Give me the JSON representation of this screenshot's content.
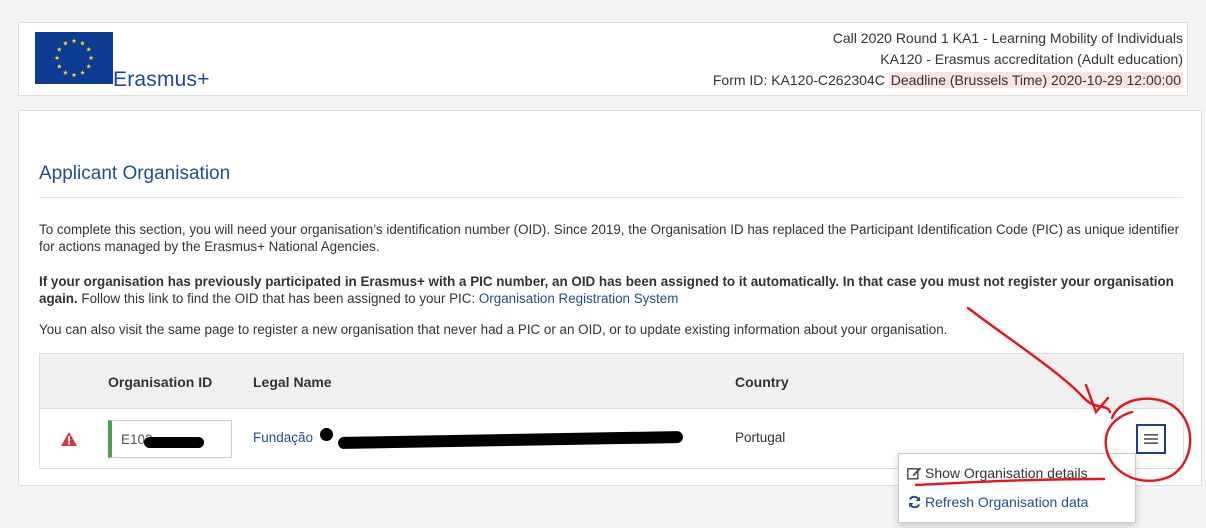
{
  "header": {
    "brand": "Erasmus+",
    "call_line_1": "Call 2020 Round 1 KA1 - Learning Mobility of Individuals",
    "call_line_2": "KA120 - Erasmus accreditation (Adult education)",
    "form_id": "Form ID: KA120-C262304C",
    "deadline": "Deadline (Brussels Time) 2020-10-29 12:00:00"
  },
  "section": {
    "title": "Applicant Organisation",
    "para_1": "To complete this section, you will need your organisation’s identification number (OID). Since 2019, the Organisation ID has replaced the Participant Identification Code (PIC) as unique identifier for actions managed by the Erasmus+ National Agencies.",
    "para_2_bold": "If your organisation has previously participated in Erasmus+ with a PIC number, an OID has been assigned to it automatically. In that case you must not register your organisation again.",
    "para_2_text": " Follow this link to find the OID that has been assigned to your PIC: ",
    "para_2_link": "Organisation Registration System",
    "para_3": "You can also visit the same page to register a new organisation that never had a PIC or an OID, or to update existing information about your organisation."
  },
  "table": {
    "headers": {
      "oid": "Organisation ID",
      "legal_name": "Legal Name",
      "country": "Country"
    },
    "rows": [
      {
        "oid": "E102",
        "legal_name": "Fundação",
        "country": "Portugal",
        "status": "warning"
      }
    ]
  },
  "menu": {
    "items": [
      {
        "label": "Show Organisation details",
        "icon": "edit-icon"
      },
      {
        "label": "Refresh Organisation data",
        "icon": "refresh-icon"
      }
    ]
  },
  "colors": {
    "brand_blue": "#1d4f91",
    "flag_blue": "#0d3b94",
    "flag_stars": "#ffdd00",
    "valid_green": "#47a447",
    "warning_red": "#d9363e",
    "annotation_red": "#e8141b",
    "deadline_bg": "#f8e3e3"
  }
}
